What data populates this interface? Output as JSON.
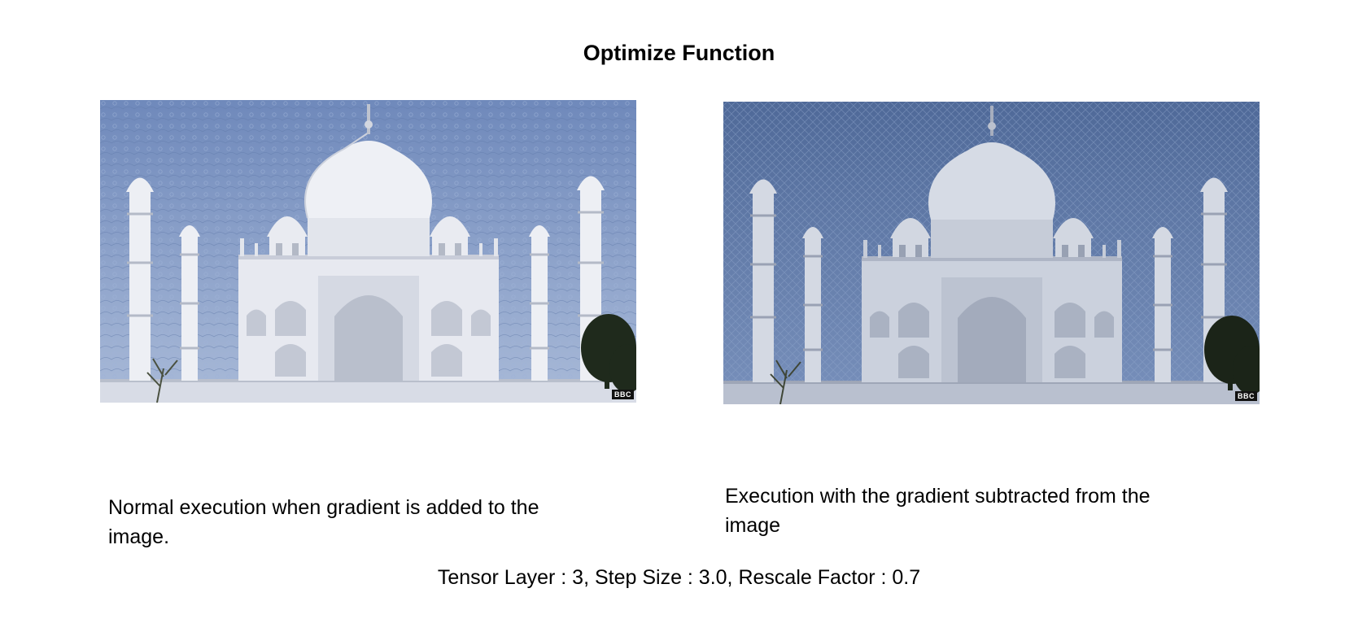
{
  "title": "Optimize Function",
  "panels": [
    {
      "caption_line1": "Normal execution when gradient is added to the",
      "caption_line2": "image.",
      "watermark": "BBC",
      "sky_color": "#7e98c6",
      "marble_color": "#e6e8ef"
    },
    {
      "caption_line1": "Execution with the gradient subtracted from the",
      "caption_line2": "image",
      "watermark": "BBC",
      "sky_color": "#5f7aa8",
      "marble_color": "#c9cfdc"
    }
  ],
  "parameters": "Tensor Layer : 3, Step Size : 3.0, Rescale Factor : 0.7"
}
